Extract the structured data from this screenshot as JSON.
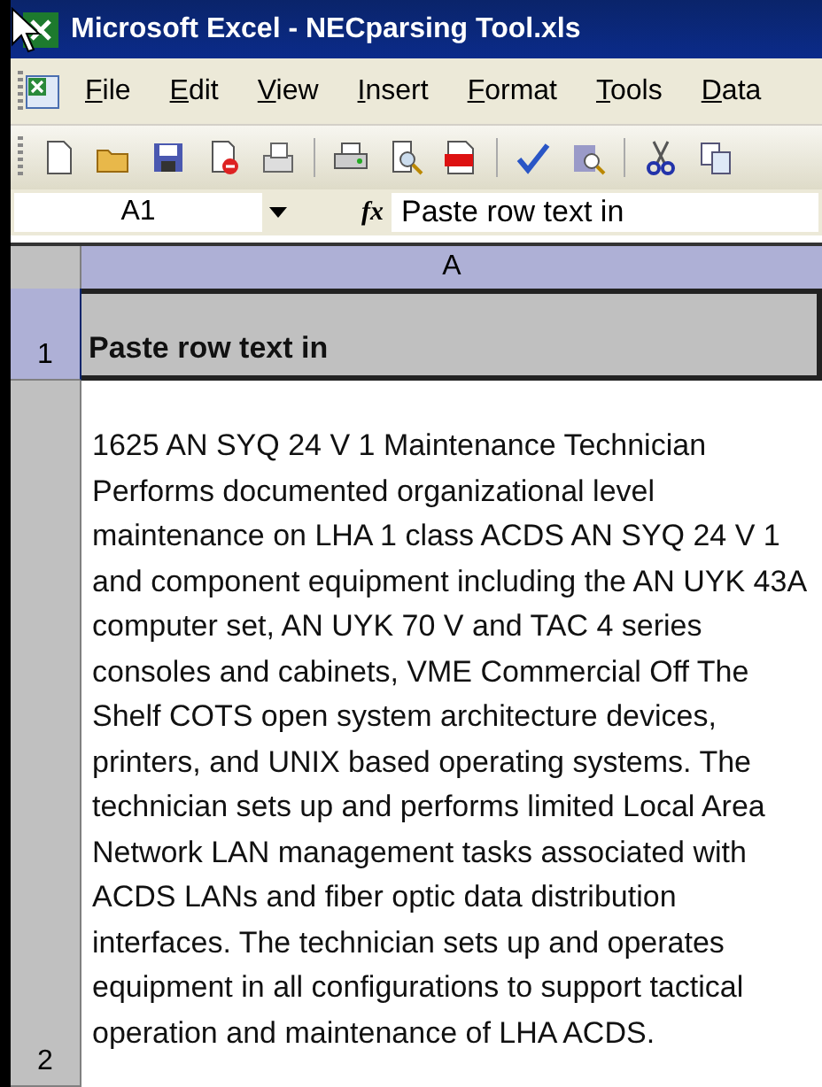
{
  "window": {
    "title": "Microsoft Excel - NECparsing Tool.xls"
  },
  "menu": [
    "File",
    "Edit",
    "View",
    "Insert",
    "Format",
    "Tools",
    "Data"
  ],
  "formula_bar": {
    "name_box": "A1",
    "fx": "fx",
    "value": "Paste row text in"
  },
  "sheet": {
    "columns": [
      {
        "label": "A",
        "selected": true
      }
    ],
    "rows": [
      {
        "number": "1",
        "selected": true,
        "text": "Paste row text in",
        "bold": true
      },
      {
        "number": "2",
        "selected": false,
        "text": "1625 AN SYQ 24 V 1 Maintenance Technician Performs documented organizational level maintenance on LHA 1 class ACDS AN SYQ 24 V 1 and component equipment including the AN UYK 43A computer set, AN UYK 70 V and TAC 4 series consoles and cabinets, VME Commercial Off The Shelf COTS open system architecture devices, printers, and UNIX based operating systems. The technician sets up and performs limited Local Area Network LAN management tasks associated with ACDS LANs and fiber optic data distribution interfaces. The technician sets up and operates equipment in all configurations to support tactical operation and maintenance of LHA ACDS.",
        "bold": false
      }
    ]
  }
}
